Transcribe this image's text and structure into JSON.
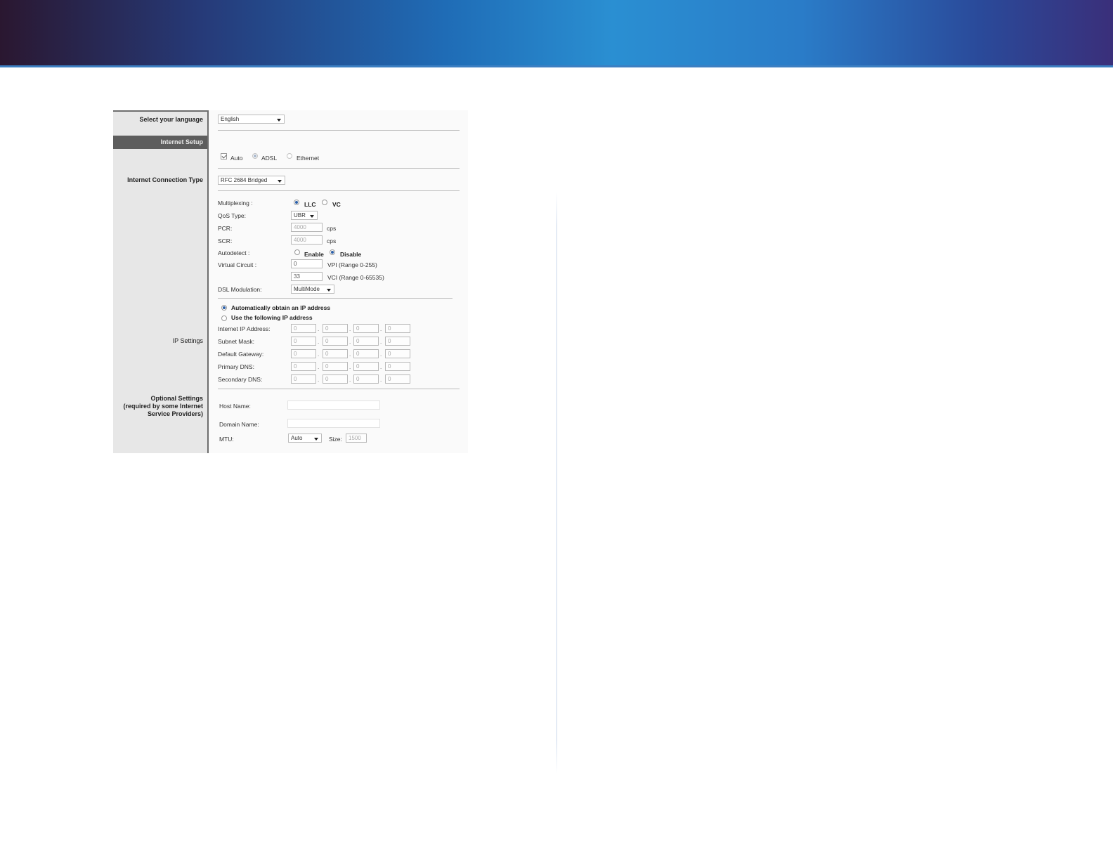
{
  "sidebar": {
    "select_language": "Select your language",
    "internet_setup": "Internet Setup",
    "connection_type": "Internet Connection Type",
    "ip_settings": "IP Settings",
    "optional_settings_l1": "Optional Settings",
    "optional_settings_l2": "(required by some Internet",
    "optional_settings_l3": "Service Providers)"
  },
  "language": {
    "selected": "English"
  },
  "wan": {
    "auto_label": "Auto",
    "auto_checked": true,
    "adsl_label": "ADSL",
    "ethernet_label": "Ethernet"
  },
  "connection_type": {
    "selected": "RFC 2684 Bridged"
  },
  "atm": {
    "multiplexing_label": "Multiplexing :",
    "llc_label": "LLC",
    "vc_label": "VC",
    "qos_label": "QoS Type:",
    "qos_value": "UBR",
    "pcr_label": "PCR:",
    "pcr_value": "4000",
    "pcr_unit": "cps",
    "scr_label": "SCR:",
    "scr_value": "4000",
    "scr_unit": "cps",
    "autodetect_label": "Autodetect :",
    "enable_label": "Enable",
    "disable_label": "Disable",
    "virtual_circuit_label": "Virtual Circuit :",
    "vpi_value": "0",
    "vpi_range": "VPI (Range 0-255)",
    "vci_value": "33",
    "vci_range": "VCI (Range 0-65535)",
    "dsl_mod_label": "DSL Modulation:",
    "dsl_mod_value": "MultiMode"
  },
  "ip": {
    "auto_obtain": "Automatically obtain an IP address",
    "use_following": "Use the following IP address",
    "rows": [
      {
        "label": "Internet IP Address:",
        "octets": [
          "0",
          "0",
          "0",
          "0"
        ]
      },
      {
        "label": "Subnet Mask:",
        "octets": [
          "0",
          "0",
          "0",
          "0"
        ]
      },
      {
        "label": "Default Gateway:",
        "octets": [
          "0",
          "0",
          "0",
          "0"
        ]
      },
      {
        "label": "Primary DNS:",
        "octets": [
          "0",
          "0",
          "0",
          "0"
        ]
      },
      {
        "label": "Secondary DNS:",
        "octets": [
          "0",
          "0",
          "0",
          "0"
        ]
      }
    ]
  },
  "optional": {
    "host_name_label": "Host Name:",
    "host_name_value": "",
    "domain_name_label": "Domain Name:",
    "domain_name_value": "",
    "mtu_label": "MTU:",
    "mtu_value": "Auto",
    "size_label": "Size:",
    "size_value": "1500"
  }
}
